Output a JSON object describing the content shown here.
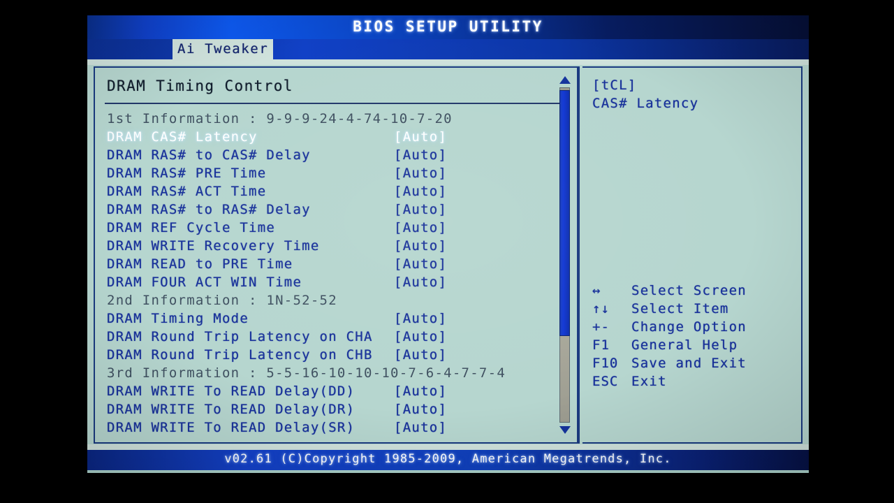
{
  "window": {
    "title": "BIOS SETUP UTILITY",
    "footer": "v02.61 (C)Copyright 1985-2009, American Megatrends, Inc."
  },
  "tabs": [
    {
      "label": "Ai Tweaker",
      "active": true
    }
  ],
  "main": {
    "section_title": "DRAM Timing Control",
    "rows": [
      {
        "label": "1st Information : 9-9-9-24-4-74-10-7-20",
        "value": "",
        "type": "info"
      },
      {
        "label": "DRAM CAS# Latency",
        "value": "[Auto]",
        "type": "setting",
        "selected": true
      },
      {
        "label": "DRAM RAS# to CAS# Delay",
        "value": "[Auto]",
        "type": "setting"
      },
      {
        "label": "DRAM RAS# PRE Time",
        "value": "[Auto]",
        "type": "setting"
      },
      {
        "label": "DRAM RAS# ACT Time",
        "value": "[Auto]",
        "type": "setting"
      },
      {
        "label": "DRAM RAS# to RAS# Delay",
        "value": "[Auto]",
        "type": "setting"
      },
      {
        "label": "DRAM REF Cycle Time",
        "value": "[Auto]",
        "type": "setting"
      },
      {
        "label": "DRAM WRITE Recovery Time",
        "value": "[Auto]",
        "type": "setting"
      },
      {
        "label": "DRAM READ to PRE Time",
        "value": "[Auto]",
        "type": "setting"
      },
      {
        "label": "DRAM FOUR ACT WIN Time",
        "value": "[Auto]",
        "type": "setting"
      },
      {
        "label": "2nd Information : 1N-52-52",
        "value": "",
        "type": "info"
      },
      {
        "label": "DRAM Timing Mode",
        "value": "[Auto]",
        "type": "setting"
      },
      {
        "label": "DRAM Round Trip Latency on CHA",
        "value": "[Auto]",
        "type": "setting"
      },
      {
        "label": "DRAM Round Trip Latency on CHB",
        "value": "[Auto]",
        "type": "setting"
      },
      {
        "label": "3rd Information : 5-5-16-10-10-10-7-6-4-7-7-4",
        "value": "",
        "type": "info"
      },
      {
        "label": "DRAM WRITE To READ Delay(DD)",
        "value": "[Auto]",
        "type": "setting"
      },
      {
        "label": "DRAM WRITE To READ Delay(DR)",
        "value": "[Auto]",
        "type": "setting"
      },
      {
        "label": "DRAM WRITE To READ Delay(SR)",
        "value": "[Auto]",
        "type": "setting"
      }
    ]
  },
  "help": {
    "title": "[tCL]",
    "description": "CAS# Latency",
    "keys": [
      {
        "key": "↔",
        "action": "Select Screen"
      },
      {
        "key": "↑↓",
        "action": "Select Item"
      },
      {
        "key": "+-",
        "action": "Change Option"
      },
      {
        "key": "F1",
        "action": "General Help"
      },
      {
        "key": "F10",
        "action": "Save and Exit"
      },
      {
        "key": "ESC",
        "action": "Exit"
      }
    ]
  },
  "scrollbar": {
    "up_arrow": "scroll-up-arrow",
    "down_arrow": "scroll-down-arrow"
  },
  "colors": {
    "screen_bg": "#b6d6cf",
    "title_blue": "#1040c8",
    "text_blue": "#17309a",
    "selected_white": "#ffffff",
    "info_grey": "#3f5060",
    "border": "#1a3a80"
  }
}
